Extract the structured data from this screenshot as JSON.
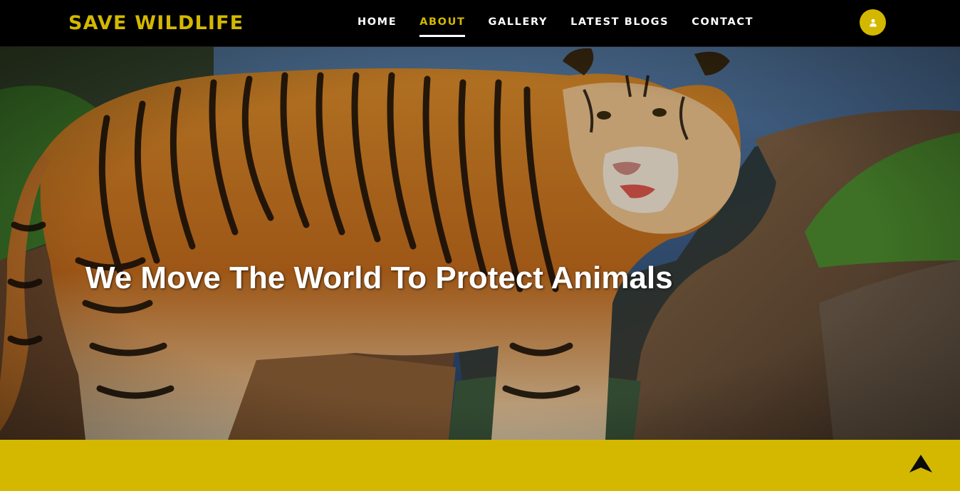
{
  "brand": {
    "name": "SAVE WILDLIFE"
  },
  "nav": {
    "items": [
      {
        "label": "HOME",
        "active": false
      },
      {
        "label": "ABOUT",
        "active": true
      },
      {
        "label": "GALLERY",
        "active": false
      },
      {
        "label": "LATEST BLOGS",
        "active": false
      },
      {
        "label": "CONTACT",
        "active": false
      }
    ]
  },
  "header": {
    "user_icon": "user-icon"
  },
  "hero": {
    "title": "We Move The World To Protect Animals",
    "image": "tiger-photo"
  },
  "scroll_top": {
    "icon": "arrow-up-icon"
  },
  "colors": {
    "accent": "#d4b800",
    "navbar_bg": "#000000",
    "nav_text": "#ffffff",
    "hero_title": "#ffffff"
  }
}
